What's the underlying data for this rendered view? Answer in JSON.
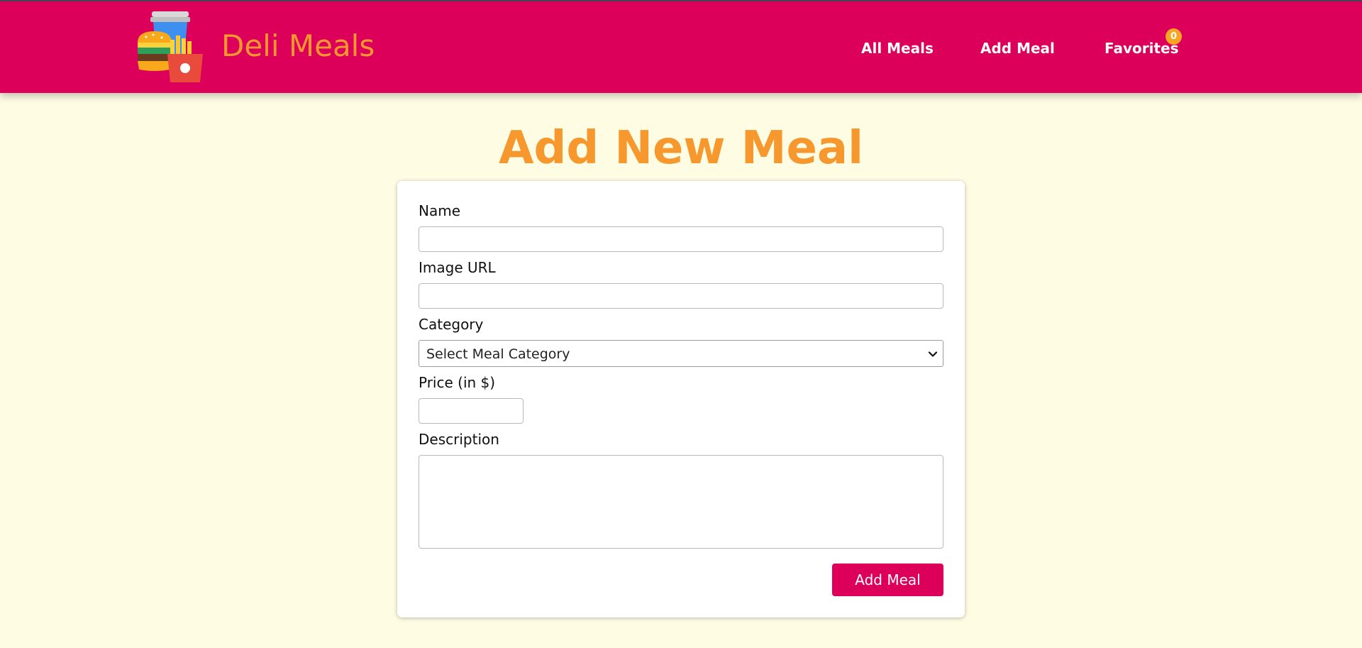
{
  "app": {
    "brand": "Deli Meals",
    "logo_icon": "fast-food-icon",
    "colors": {
      "header": "#dc005a",
      "accent": "#f6982e",
      "background": "#fefce3",
      "badge": "#f6a623"
    }
  },
  "nav": {
    "all_meals": "All Meals",
    "add_meal": "Add Meal",
    "favorites": "Favorites",
    "favorites_count": "0"
  },
  "page": {
    "title": "Add New Meal"
  },
  "form": {
    "name_label": "Name",
    "name_value": "",
    "image_label": "Image URL",
    "image_value": "",
    "category_label": "Category",
    "category_selected": "Select Meal Category",
    "price_label": "Price (in $)",
    "price_value": "",
    "description_label": "Description",
    "description_value": "",
    "submit_label": "Add Meal"
  }
}
